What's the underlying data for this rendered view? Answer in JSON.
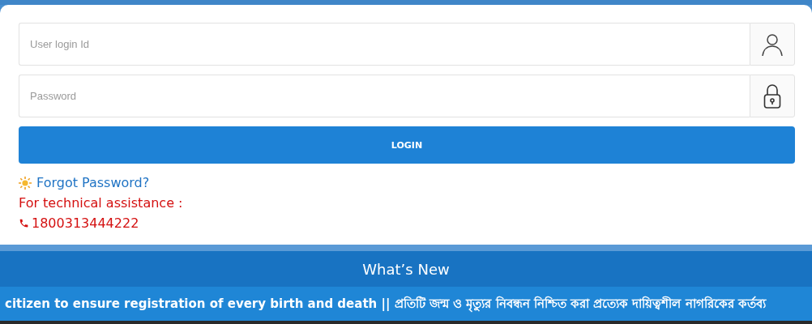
{
  "login_form": {
    "user_field": {
      "placeholder": "User login Id"
    },
    "password_field": {
      "placeholder": "Password"
    },
    "login_button": "LOGIN",
    "forgot_password": "Forgot Password?",
    "assistance_label": "For technical assistance :",
    "phone": "1800313444222"
  },
  "whats_new": {
    "title": "What’s New",
    "ticker": "citizen to ensure registration of every birth and death || প্রতিটি জন্ম ও মৃত্যুর নিবন্ধন নিশ্চিত করা প্রত্যেক দায়িত্বশীল নাগরিকের কর্তব্য"
  }
}
